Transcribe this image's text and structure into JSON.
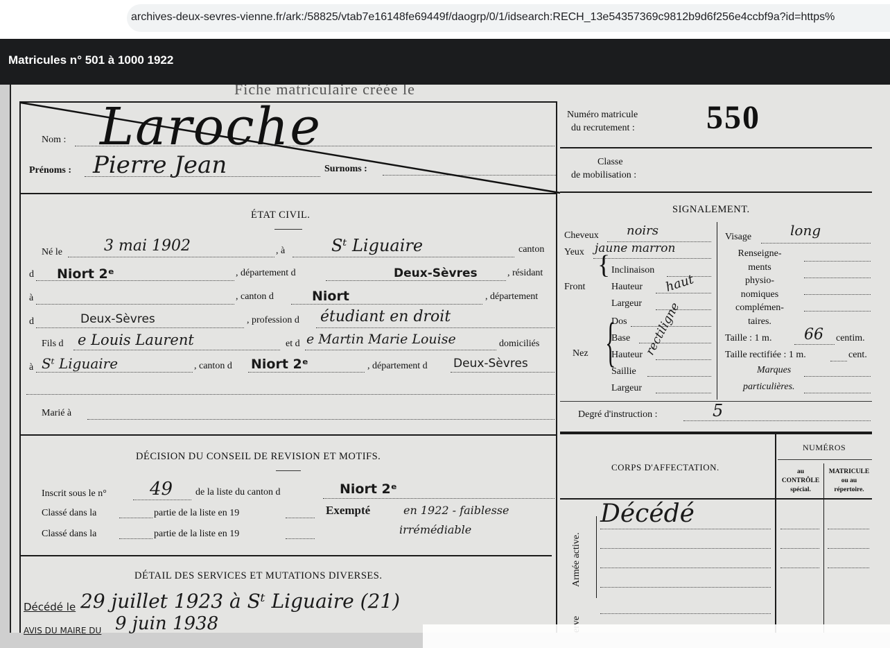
{
  "browser": {
    "url": "archives-deux-sevres-vienne.fr/ark:/58825/vtab7e16148fe69449f/daogrp/0/1/idsearch:RECH_13e54357369c9812b9d6f256e4ccbf9a?id=https%"
  },
  "viewer": {
    "title": "Matricules n° 501 à 1000 1922"
  },
  "document": {
    "header_faint": "Fiche matriculaire créée le",
    "name": {
      "label": "Nom :",
      "value": "Laroche"
    },
    "prenoms": {
      "label": "Prénoms :",
      "value": "Pierre Jean"
    },
    "surnoms_label": "Surnoms :",
    "matricule": {
      "label1": "Numéro matricule",
      "label2": "du recrutement :",
      "value": "550"
    },
    "classe": {
      "label1": "Classe",
      "label2": "de mobilisation :"
    },
    "etat_civil": {
      "heading": "ÉTAT CIVIL.",
      "ne_le_label": "Né le",
      "ne_le_value": "3 mai 1902",
      "a_label": ", à",
      "lieu_value": "Sᵗ Liguaire",
      "canton_label": "canton",
      "d1": "d",
      "canton1_value": "Niort 2ᵉ",
      "departement_label1": ", département d",
      "departement1_value": "Deux-Sèvres",
      "residant_label": ", résidant",
      "a2": "à",
      "canton_d_label": ", canton d",
      "canton2_value": "Niort",
      "departement_label2": ", département",
      "d2": "d",
      "departement2_value": "Deux-Sèvres",
      "profession_label": ", profession d",
      "profession_value": "étudiant en droit",
      "fils_label": "Fils d",
      "pere_value": "e Louis Laurent",
      "et_de_label": "et d",
      "mere_value": "e Martin Marie Louise",
      "domicilies_label": "domiciliés",
      "a3": "à",
      "domicile_value": "Sᵗ Liguaire",
      "canton_d_label2": ", canton d",
      "canton3_value": "Niort 2ᵉ",
      "departement_label3": ", département d",
      "departement3_value": "Deux-Sèvres",
      "marie_label": "Marié à"
    },
    "signalement": {
      "heading": "SIGNALEMENT.",
      "cheveux_label": "Cheveux",
      "cheveux_value": "noirs",
      "yeux_label": "Yeux",
      "yeux_value": "jaune marron",
      "front_label": "Front",
      "inclinaison_label": "Inclinaison",
      "hauteur_label": "Hauteur",
      "hauteur_value": "haut",
      "largeur_label": "Largeur",
      "nez_label": "Nez",
      "dos_label": "Dos",
      "base_label": "Base",
      "nez_hauteur_label": "Hauteur",
      "saillie_label": "Saillie",
      "nez_largeur_label": "Largeur",
      "nez_value": "rectiligne",
      "visage_label": "Visage",
      "visage_value": "long",
      "renseignements_lines": [
        "Renseigne-",
        "ments",
        "physio-",
        "nomiques",
        "complémen-",
        "taires."
      ],
      "taille_label": "Taille : 1 m.",
      "taille_value": "66",
      "centim_label": "centim.",
      "taille_rectifiee_label": "Taille rectifiée : 1 m.",
      "cent_label": "cent.",
      "marques_label1": "Marques",
      "marques_label2": "particulières.",
      "degre_label": "Degré d'instruction :",
      "degre_value": "5"
    },
    "decision": {
      "heading": "DÉCISION DU CONSEIL DE REVISION ET MOTIFS.",
      "inscrit_label": "Inscrit sous le n°",
      "inscrit_value": "49",
      "liste_label": "de la liste du canton d",
      "canton_value": "Niort 2ᵉ",
      "classe1_label": "Classé dans la",
      "partie_label": "partie de la liste en 19",
      "exempte_label": "Exempté",
      "exempte_value": "en 1922 - faiblesse",
      "irremediable_value": "irrémédiable",
      "classe2_label": "Classé dans la",
      "partie2_label": "partie de la liste en 19"
    },
    "corps": {
      "heading": "CORPS D'AFFECTATION.",
      "numeros_heading": "NUMÉROS",
      "controle_lines": [
        "au",
        "CONTRÔLE",
        "spécial."
      ],
      "repertoire_lines": [
        "MATRICULE",
        "ou au",
        "répertoire."
      ],
      "armee_active_label": "Armée active.",
      "reserve_label": "erve",
      "decede_value": "Décédé"
    },
    "services": {
      "heading": "DÉTAIL DES SERVICES ET MUTATIONS DIVERSES.",
      "decede_label": "Décédé le",
      "decede_value": "29 juillet 1923 à Sᵗ Liguaire (21)",
      "avis_label": "AVIS DU MAIRE DU",
      "avis_value": "9 juin 1938"
    }
  }
}
